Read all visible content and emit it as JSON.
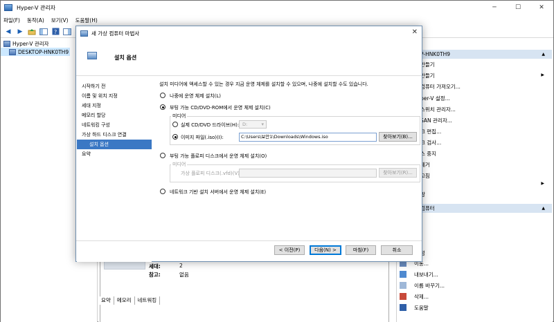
{
  "app": {
    "title": "Hyper-V 관리자",
    "window_controls": {
      "minimize": "─",
      "maximize": "☐",
      "close": "✕"
    }
  },
  "menu": [
    "파일(F)",
    "동작(A)",
    "보기(V)",
    "도움말(H)"
  ],
  "tree": {
    "root": "Hyper-V 관리자",
    "host": "DESKTOP-HNK0TH9"
  },
  "details": {
    "rows": [
      {
        "key": "세대:",
        "value": "2"
      },
      {
        "key": "참고:",
        "value": "없음"
      }
    ],
    "tabs": [
      "요약",
      "메모리",
      "네트워킹"
    ]
  },
  "actions": {
    "host_header": "P-HNK0TH9",
    "host_items": [
      "만들기",
      "만들기",
      "컴퓨터 가져오기...",
      "rper-V 설정...",
      "스위치 관리자...",
      "SAN 관리자...",
      "크 편집...",
      "크 검사...",
      "스 중지",
      "제거",
      "고침",
      "말"
    ],
    "vm_header": "컴퓨터",
    "vm_items": [
      "정",
      "이동...",
      "내보내기...",
      "이름 바꾸기...",
      "삭제...",
      "도움말"
    ]
  },
  "wizard": {
    "title": "새 가상 컴퓨터 마법사",
    "page_title": "설치 옵션",
    "close": "✕",
    "steps": [
      "시작하기 전",
      "이름 및 위치 지정",
      "세대 지정",
      "메모리 할당",
      "네트워킹 구성",
      "가상 하드 디스크 연결",
      "설치 옵션",
      "요약"
    ],
    "active_step": 6,
    "intro": "설치 미디어에 액세스할 수 있는 경우 지금 운영 체제를 설치할 수 있으며, 나중에 설치할 수도 있습니다.",
    "option_later": "나중에 운영 체제 설치(L)",
    "option_cd": "부팅 가능 CD/DVD-ROM에서 운영 체제 설치(C)",
    "media_label": "미디어",
    "physical_drive": "실제 CD/DVD 드라이브(H):",
    "drive_value": "D:",
    "image_file": "이미지 파일(.iso)(I):",
    "image_path": "C:\\Users\\보안1\\Downloads\\Windows.iso",
    "browse_label": "찾아보기(B)...",
    "option_floppy": "부팅 가능 플로피 디스크에서 운영 체제 설치(O)",
    "floppy_media_label": "미디어",
    "floppy_label": "가상 플로피 디스크(.vfd)(V):",
    "floppy_browse": "찾아보기(R)...",
    "option_network": "네트워크 기반 설치 서버에서 운영 체제 설치(E)",
    "buttons": {
      "prev": "< 이전(P)",
      "next": "다음(N) >",
      "finish": "마침(F)",
      "cancel": "취소"
    }
  }
}
